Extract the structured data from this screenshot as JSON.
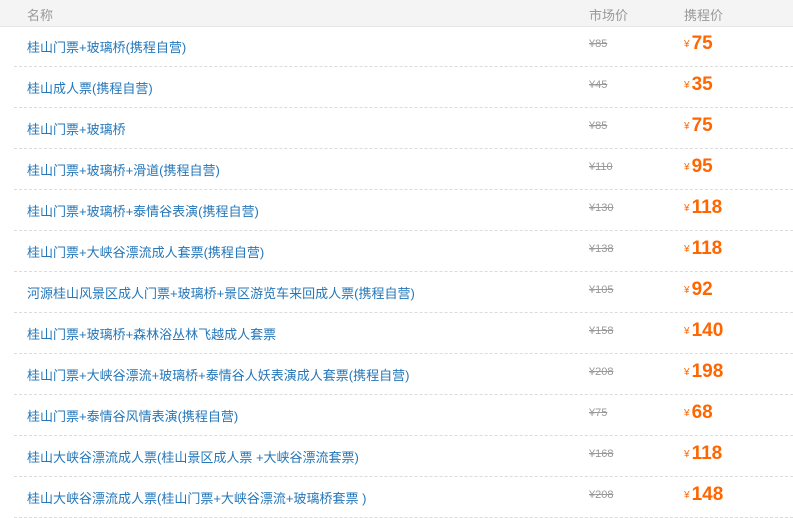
{
  "header": {
    "name": "名称",
    "market_price": "市场价",
    "ctrip_price": "携程价"
  },
  "currency": "¥",
  "rows": [
    {
      "name": "桂山门票+玻璃桥(携程自营)",
      "market": "¥85",
      "price": "75"
    },
    {
      "name": "桂山成人票(携程自营)",
      "market": "¥45",
      "price": "35"
    },
    {
      "name": "桂山门票+玻璃桥",
      "market": "¥85",
      "price": "75"
    },
    {
      "name": "桂山门票+玻璃桥+滑道(携程自营)",
      "market": "¥110",
      "price": "95"
    },
    {
      "name": "桂山门票+玻璃桥+泰情谷表演(携程自营)",
      "market": "¥130",
      "price": "118"
    },
    {
      "name": "桂山门票+大峡谷漂流成人套票(携程自营)",
      "market": "¥138",
      "price": "118"
    },
    {
      "name": "河源桂山风景区成人门票+玻璃桥+景区游览车来回成人票(携程自营)",
      "market": "¥105",
      "price": "92"
    },
    {
      "name": "桂山门票+玻璃桥+森林浴丛林飞越成人套票",
      "market": "¥158",
      "price": "140"
    },
    {
      "name": "桂山门票+大峡谷漂流+玻璃桥+泰情谷人妖表演成人套票(携程自营)",
      "market": "¥208",
      "price": "198"
    },
    {
      "name": "桂山门票+泰情谷风情表演(携程自营)",
      "market": "¥75",
      "price": "68"
    },
    {
      "name": "桂山大峡谷漂流成人票(桂山景区成人票 +大峡谷漂流套票)",
      "market": "¥168",
      "price": "118"
    },
    {
      "name": "桂山大峡谷漂流成人票(桂山门票+大峡谷漂流+玻璃桥套票 )",
      "market": "¥208",
      "price": "148"
    }
  ],
  "colors": {
    "link": "#2577b9",
    "price": "#ff6600",
    "muted": "#999999",
    "header_bg": "#f4f4f4"
  }
}
